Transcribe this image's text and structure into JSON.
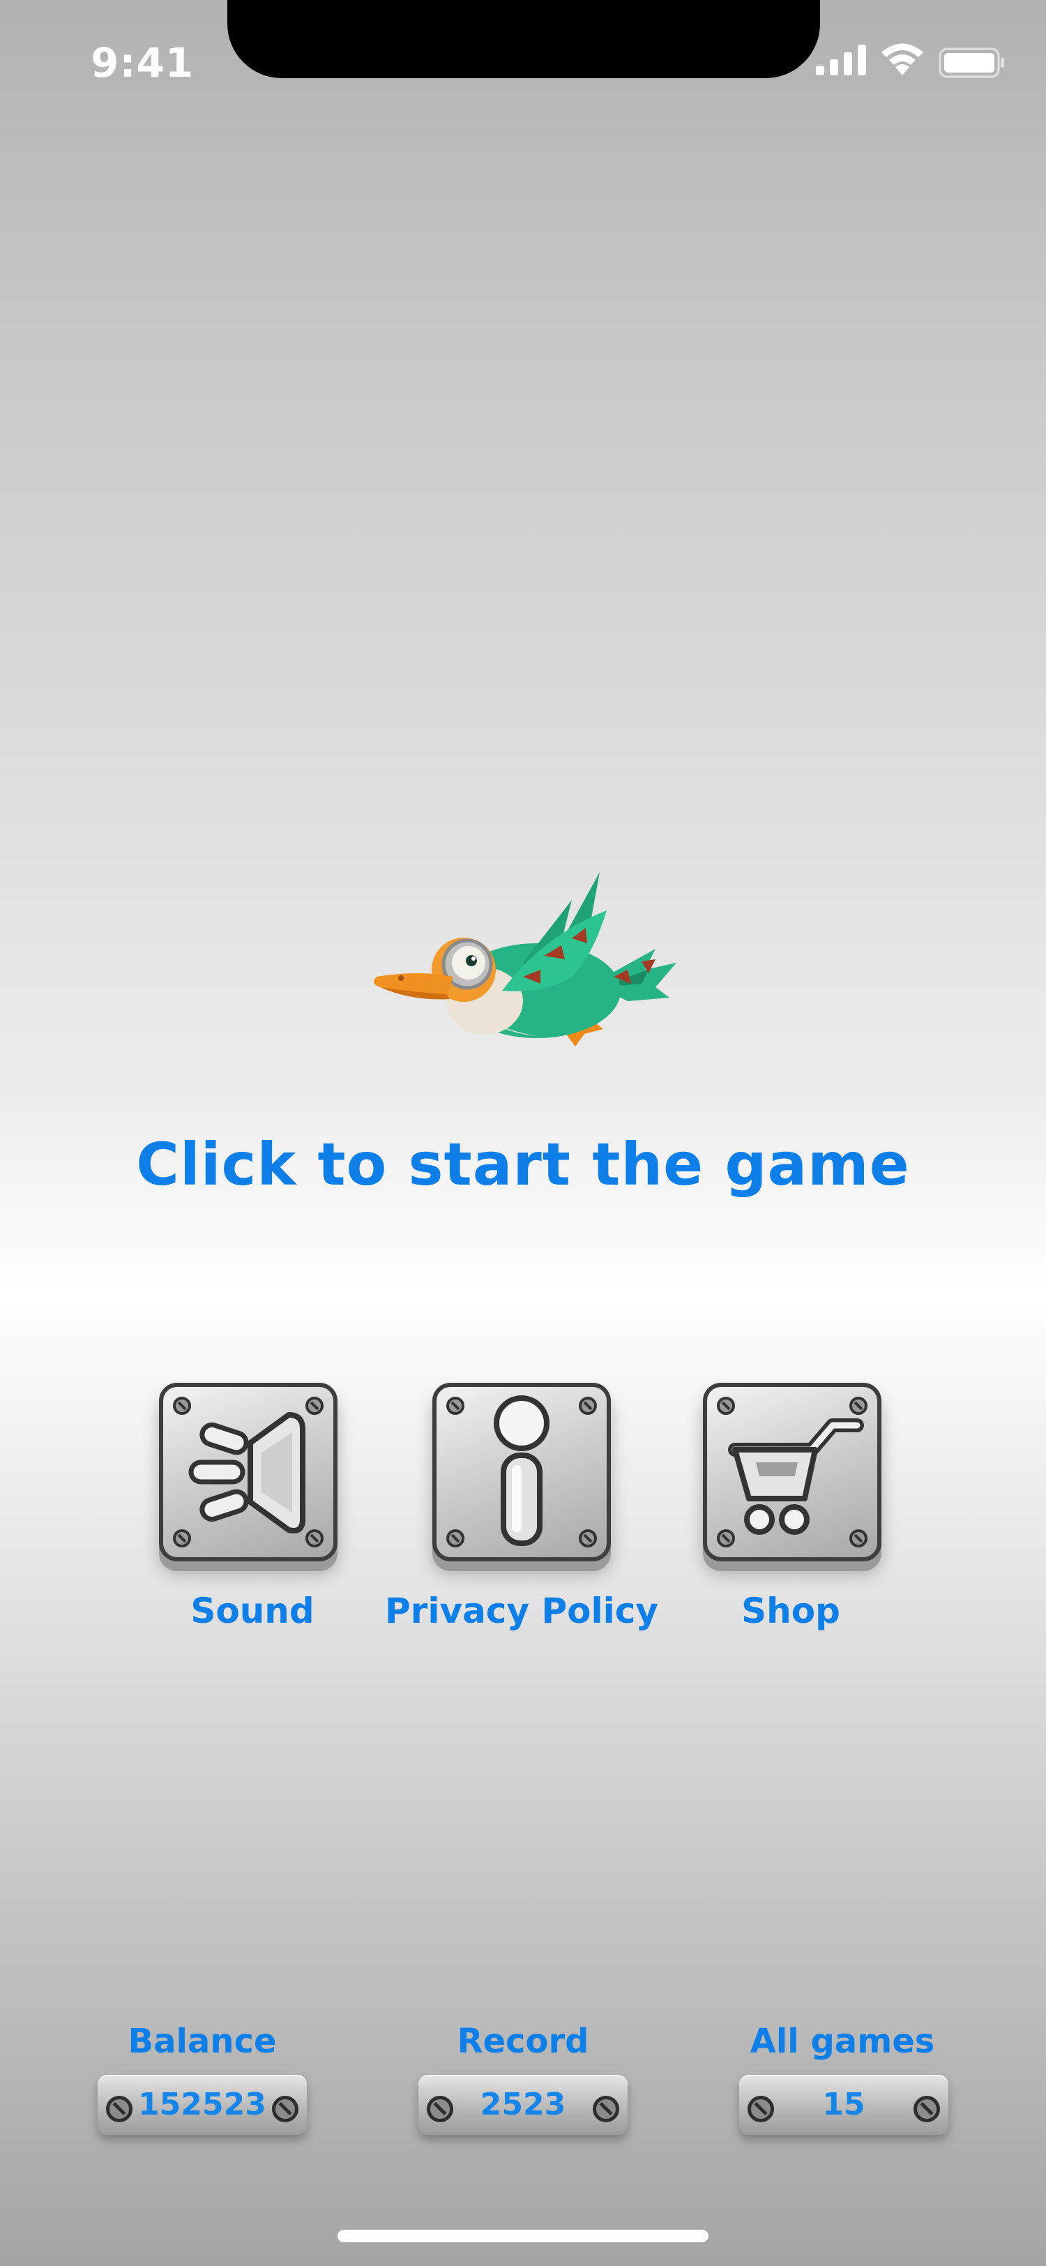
{
  "status_bar": {
    "time": "9:41"
  },
  "hero": {
    "prompt": "Click to start the game"
  },
  "menu": {
    "sound_label": "Sound",
    "privacy_label": "Privacy Policy",
    "shop_label": "Shop"
  },
  "stats": {
    "balance_label": "Balance",
    "balance_value": "152523",
    "record_label": "Record",
    "record_value": "2523",
    "games_label": "All games",
    "games_value": "15"
  },
  "icons": [
    "signal-icon",
    "wifi-icon",
    "battery-icon",
    "duck-icon",
    "speaker-icon",
    "info-icon",
    "cart-icon",
    "screw-icon"
  ],
  "colors": {
    "accent": "#0e7fe8",
    "plate_border": "#3e3e3e"
  }
}
